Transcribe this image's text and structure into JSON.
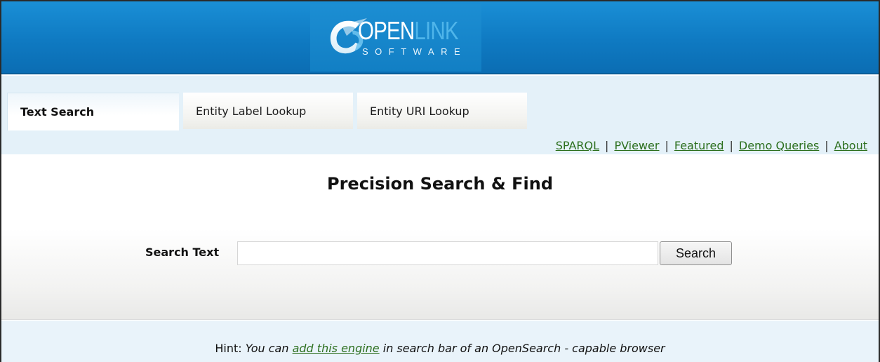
{
  "header": {
    "logo": {
      "word_open": "OPEN",
      "word_link": "LINK",
      "subtitle": "SOFTWARE"
    },
    "colors": {
      "bar": "#1081c7",
      "logo_link": "#4fb5ea"
    }
  },
  "tabs": [
    {
      "label": "Text Search",
      "active": true
    },
    {
      "label": "Entity Label Lookup",
      "active": false
    },
    {
      "label": "Entity URI Lookup",
      "active": false
    }
  ],
  "toplinks": [
    {
      "label": "SPARQL"
    },
    {
      "label": "PViewer"
    },
    {
      "label": "Featured"
    },
    {
      "label": "Demo Queries"
    },
    {
      "label": "About"
    }
  ],
  "toplinks_separator": "|",
  "main": {
    "title": "Precision Search & Find",
    "search_label": "Search Text",
    "search_value": "",
    "search_button": "Search"
  },
  "footer": {
    "hint_prefix": "Hint:",
    "hint_italic_a": "You can",
    "hint_link": "add this engine",
    "hint_italic_b": "in search bar of an OpenSearch - capable browser"
  },
  "colors": {
    "link": "#2c6f1e",
    "tab_bg": "#e4f1f9"
  }
}
